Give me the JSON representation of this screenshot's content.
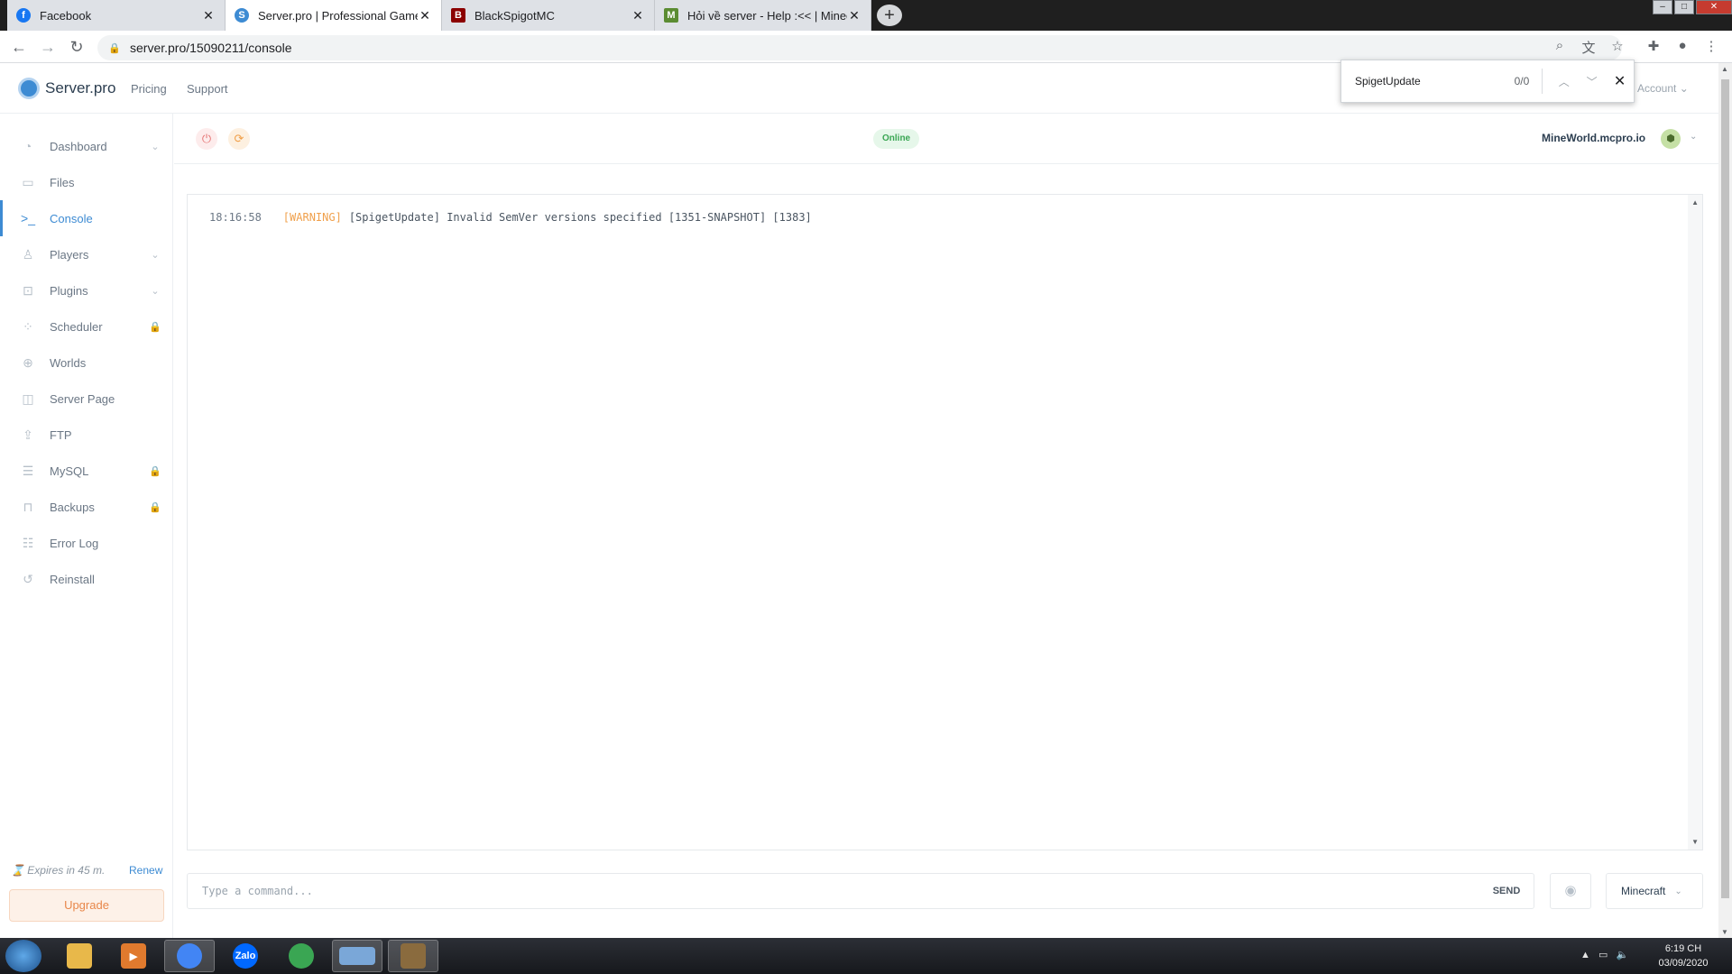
{
  "browser": {
    "tabs": [
      {
        "title": "Facebook",
        "icon": "facebook-icon",
        "color": "#1877f2",
        "glyph": "f"
      },
      {
        "title": "Server.pro | Professional Game S",
        "icon": "serverpro-icon",
        "color": "#3d8bd3",
        "glyph": "S"
      },
      {
        "title": "BlackSpigotMC",
        "icon": "blackspigot-icon",
        "color": "#8b0000",
        "glyph": "B"
      },
      {
        "title": "Hỏi về server - Help :<< | Minecr",
        "icon": "minecraft-icon",
        "color": "#5b8c32",
        "glyph": "M"
      }
    ],
    "url": "server.pro/15090211/console",
    "find": {
      "query": "SpigetUpdate",
      "count": "0/0"
    }
  },
  "header": {
    "brand": "Server.pro",
    "links": [
      "Pricing",
      "Support"
    ],
    "account": "Account"
  },
  "sidebar": {
    "items": [
      {
        "label": "Dashboard",
        "icon": "dashboard-icon",
        "glyph": "◔",
        "side": "⌄"
      },
      {
        "label": "Files",
        "icon": "files-icon",
        "glyph": "▭",
        "side": ""
      },
      {
        "label": "Console",
        "icon": "console-icon",
        "glyph": ">_",
        "side": ""
      },
      {
        "label": "Players",
        "icon": "players-icon",
        "glyph": "♙",
        "side": "⌄"
      },
      {
        "label": "Plugins",
        "icon": "plugins-icon",
        "glyph": "⊡",
        "side": "⌄"
      },
      {
        "label": "Scheduler",
        "icon": "scheduler-icon",
        "glyph": "⁘",
        "side": "🔒"
      },
      {
        "label": "Worlds",
        "icon": "worlds-icon",
        "glyph": "⊕",
        "side": ""
      },
      {
        "label": "Server Page",
        "icon": "server-page-icon",
        "glyph": "◫",
        "side": ""
      },
      {
        "label": "FTP",
        "icon": "ftp-icon",
        "glyph": "⇪",
        "side": ""
      },
      {
        "label": "MySQL",
        "icon": "mysql-icon",
        "glyph": "☰",
        "side": "🔒"
      },
      {
        "label": "Backups",
        "icon": "backups-icon",
        "glyph": "⊓",
        "side": "🔒"
      },
      {
        "label": "Error Log",
        "icon": "error-log-icon",
        "glyph": "☷",
        "side": ""
      },
      {
        "label": "Reinstall",
        "icon": "reinstall-icon",
        "glyph": "↺",
        "side": ""
      }
    ],
    "active": "Console",
    "expires": "Expires in 45 m.",
    "renew": "Renew",
    "upgrade": "Upgrade"
  },
  "server": {
    "status": "Online",
    "name": "MineWorld.mcpro.io"
  },
  "console": {
    "lines": [
      {
        "time": "18:16:58",
        "level": "[WARNING]",
        "message": "[SpigetUpdate] Invalid SemVer versions specified [1351-SNAPSHOT] [1383]"
      }
    ],
    "placeholder": "Type a command...",
    "send": "SEND",
    "mode": "Minecraft"
  },
  "taskbar": {
    "apps": [
      {
        "name": "file-explorer",
        "color": "#e8b84a"
      },
      {
        "name": "media-player",
        "color": "#e07a2e"
      },
      {
        "name": "chrome",
        "color": "#4285f4"
      },
      {
        "name": "zalo",
        "color": "#0068ff",
        "label": "Zalo"
      },
      {
        "name": "app-green",
        "color": "#3aa653"
      },
      {
        "name": "on-screen-keyboard",
        "color": "#7aa7d8"
      },
      {
        "name": "minecraft",
        "color": "#8a6b3e"
      }
    ],
    "time": "6:19 CH",
    "date": "03/09/2020"
  }
}
